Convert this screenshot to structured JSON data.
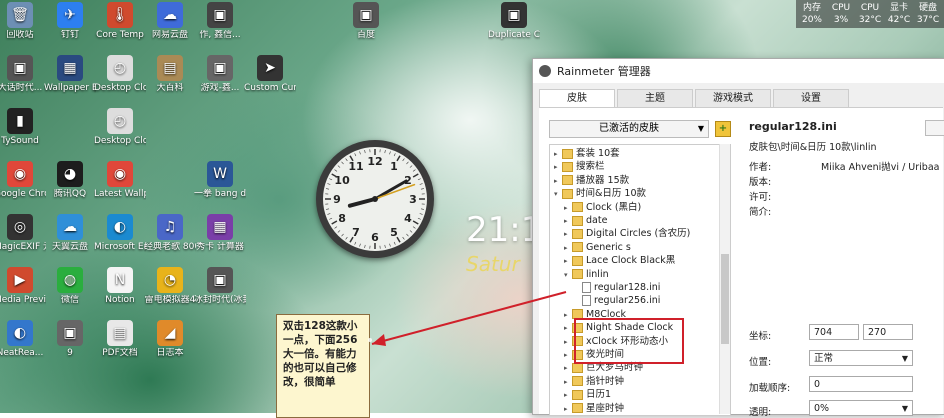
{
  "desktop_icons": [
    {
      "label": "回收站",
      "color": "#6d8fb4",
      "glyph": "🗑"
    },
    {
      "label": "钉钉",
      "color": "#2d7ff0",
      "glyph": "✈"
    },
    {
      "label": "Core Temp",
      "color": "#d04a2e",
      "glyph": "🌡"
    },
    {
      "label": "网易云盘",
      "color": "#3f6bd9",
      "glyph": "☁"
    },
    {
      "label": "作, 鑫信...",
      "color": "#444",
      "glyph": "▣"
    },
    {
      "label": "大话时代...",
      "color": "#555",
      "glyph": "▣"
    },
    {
      "label": "Wallpaper Engine:...",
      "color": "#2a4a80",
      "glyph": "▦"
    },
    {
      "label": "Desktop Clock-7",
      "color": "#ddd",
      "glyph": "◴"
    },
    {
      "label": "大百科",
      "color": "#aa8a55",
      "glyph": "▤"
    },
    {
      "label": "游戏-鑫...",
      "color": "#666",
      "glyph": "▣"
    },
    {
      "label": "Custom Cursor",
      "color": "#333",
      "glyph": "➤"
    },
    {
      "label": "TySound",
      "color": "#222",
      "glyph": "▮"
    },
    {
      "label": "Desktop Clock",
      "color": "#ddd",
      "glyph": "◴"
    },
    {
      "label": "Google Chrome",
      "color": "#e0473a",
      "glyph": "◉"
    },
    {
      "label": "腾讯QQ",
      "color": "#1d1d1d",
      "glyph": "◕"
    },
    {
      "label": "Latest Wallpap...",
      "color": "#e0473a",
      "glyph": "◉"
    },
    {
      "label": "MagicEXIF 元数据编...",
      "color": "#333",
      "glyph": "◎"
    },
    {
      "label": "天翼云盘",
      "color": "#2f8fd8",
      "glyph": "☁"
    },
    {
      "label": "Microsoft Edge",
      "color": "#1b8ad0",
      "glyph": "◐"
    },
    {
      "label": "经典老歌 800首M...",
      "color": "#4a67c7",
      "glyph": "♫"
    },
    {
      "label": "秀卡 计算器",
      "color": "#7a3ea8",
      "glyph": "▦"
    },
    {
      "label": "Media Preview...",
      "color": "#d04a2e",
      "glyph": "▶"
    },
    {
      "label": "微信",
      "color": "#2aae3e",
      "glyph": "◍"
    },
    {
      "label": "Notion",
      "color": "#f4f4f4",
      "glyph": "N"
    },
    {
      "label": "雷电模拟器4",
      "color": "#e8b31a",
      "glyph": "◔"
    },
    {
      "label": "冰封时代(冰封时代...",
      "color": "#555",
      "glyph": "▣"
    },
    {
      "label": "NeatRea...",
      "color": "#3377cc",
      "glyph": "◐"
    },
    {
      "label": "9",
      "color": "#666",
      "glyph": "▣"
    },
    {
      "label": "PDF文档",
      "color": "#e8e8e8",
      "glyph": "▤"
    },
    {
      "label": "日志本",
      "color": "#e08a2a",
      "glyph": "◢"
    },
    {
      "label": "一拳 bang du1.docx",
      "color": "#2b5797",
      "glyph": "W"
    },
    {
      "label": "Duplicate Cleaner...",
      "color": "#333",
      "glyph": "▣"
    },
    {
      "label": "百度",
      "color": "#555",
      "glyph": "▣"
    }
  ],
  "clock": {
    "numbers": [
      "12",
      "1",
      "2",
      "3",
      "4",
      "5",
      "6",
      "7",
      "8",
      "9",
      "10",
      "11"
    ]
  },
  "wallpaper_time": {
    "time": "21:1",
    "day": "Satur"
  },
  "annotation_note": {
    "text": "双击128这款小一点，下面256大一倍。有能力的也可以自己修改，很简单"
  },
  "system_monitor": {
    "labels": [
      "内存",
      "CPU",
      "CPU",
      "显卡",
      "硬盘"
    ],
    "values": [
      "20%",
      "3%",
      "32°C",
      "42°C",
      "37°C"
    ]
  },
  "window": {
    "title": "Rainmeter 管理器",
    "tabs": [
      "皮肤",
      "主题",
      "游戏模式",
      "设置"
    ],
    "active_tab": 0,
    "skin_dropdown": "已激活的皮肤",
    "tree": [
      {
        "indent": 0,
        "type": "folder",
        "label": "套装 10套"
      },
      {
        "indent": 0,
        "type": "folder",
        "label": "搜索栏"
      },
      {
        "indent": 0,
        "type": "folder",
        "label": "播放器 15款"
      },
      {
        "indent": 0,
        "type": "folder",
        "label": "时间&日历 10款",
        "expanded": true
      },
      {
        "indent": 1,
        "type": "folder",
        "label": "Clock (黑白)"
      },
      {
        "indent": 1,
        "type": "folder",
        "label": "date"
      },
      {
        "indent": 1,
        "type": "folder",
        "label": "Digital Circles (含农历)"
      },
      {
        "indent": 1,
        "type": "folder",
        "label": "Generic s"
      },
      {
        "indent": 1,
        "type": "folder",
        "label": "Lace Clock Black黑"
      },
      {
        "indent": 1,
        "type": "folder",
        "label": "linlin",
        "expanded": true
      },
      {
        "indent": 2,
        "type": "file",
        "label": "regular128.ini"
      },
      {
        "indent": 2,
        "type": "file",
        "label": "regular256.ini"
      },
      {
        "indent": 1,
        "type": "folder",
        "label": "M8Clock"
      },
      {
        "indent": 1,
        "type": "folder",
        "label": "Night Shade Clock"
      },
      {
        "indent": 1,
        "type": "folder",
        "label": "xClock 环形动态小"
      },
      {
        "indent": 1,
        "type": "folder",
        "label": "夜光时间"
      },
      {
        "indent": 1,
        "type": "folder",
        "label": "巨大罗马时钟"
      },
      {
        "indent": 1,
        "type": "folder",
        "label": "指针时钟"
      },
      {
        "indent": 1,
        "type": "folder",
        "label": "日历1"
      },
      {
        "indent": 1,
        "type": "folder",
        "label": "星座时钟"
      }
    ],
    "selected_skin": "regular128.ini",
    "skin_path": "皮肤包\\时间&日历 10款\\linlin",
    "meta": [
      {
        "label": "作者:",
        "value": "Miika Ahveni抛vi / Uribaa"
      },
      {
        "label": "版本:",
        "value": ""
      },
      {
        "label": "许可:",
        "value": ""
      },
      {
        "label": "简介:",
        "value": ""
      }
    ],
    "settings": {
      "coords_label": "坐标:",
      "x": "704",
      "y": "270",
      "position_label": "位置:",
      "position_value": "正常",
      "load_order_label": "加载顺序:",
      "load_order_value": "0",
      "transparency_label": "透明:",
      "transparency_value": "0%"
    }
  }
}
